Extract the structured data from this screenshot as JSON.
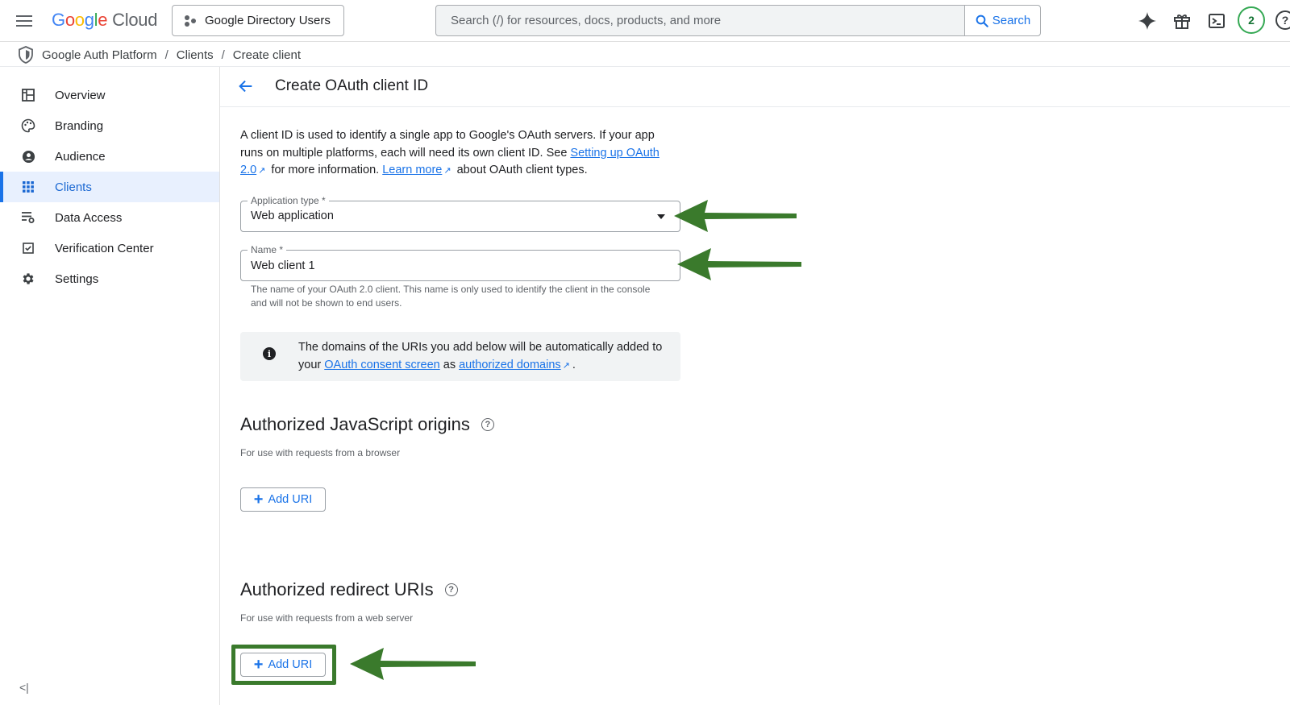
{
  "topbar": {
    "logo_letters": [
      "G",
      "o",
      "o",
      "g",
      "l",
      "e"
    ],
    "logo_product": "Cloud",
    "project_name": "Google Directory Users",
    "search_placeholder": "Search (/) for resources, docs, products, and more",
    "search_button": "Search",
    "avatar_initial": "2",
    "help_glyph": "?"
  },
  "breadcrumb": {
    "items": [
      "Google Auth Platform",
      "Clients",
      "Create client"
    ],
    "separator": "/"
  },
  "sidebar": {
    "items": [
      {
        "label": "Overview",
        "icon": "dashboard-icon"
      },
      {
        "label": "Branding",
        "icon": "palette-icon"
      },
      {
        "label": "Audience",
        "icon": "person-circle-icon"
      },
      {
        "label": "Clients",
        "icon": "grid-dots-icon",
        "active": true
      },
      {
        "label": "Data Access",
        "icon": "data-settings-icon"
      },
      {
        "label": "Verification Center",
        "icon": "checkbox-icon"
      },
      {
        "label": "Settings",
        "icon": "gear-icon"
      }
    ],
    "collapse_glyph": "<|"
  },
  "page": {
    "title": "Create OAuth client ID",
    "intro_part1": "A client ID is used to identify a single app to Google's OAuth servers. If your app runs on multiple platforms, each will need its own client ID. See ",
    "intro_link1": "Setting up OAuth 2.0",
    "intro_part2": " for more information. ",
    "intro_link2": "Learn more",
    "intro_part3": " about OAuth client types."
  },
  "form": {
    "app_type_label": "Application type *",
    "app_type_value": "Web application",
    "name_label": "Name *",
    "name_value": "Web client 1",
    "name_helper": "The name of your OAuth 2.0 client. This name is only used to identify the client in the console and will not be shown to end users."
  },
  "info": {
    "icon_glyph": "i",
    "text_part1": "The domains of the URIs you add below will be automatically added to your ",
    "link1": "OAuth consent screen",
    "text_part2": " as ",
    "link2": "authorized domains",
    "text_part3": "."
  },
  "js_origins": {
    "title": "Authorized JavaScript origins",
    "subtitle": "For use with requests from a browser",
    "button": "Add URI"
  },
  "redirect_uris": {
    "title": "Authorized redirect URIs",
    "subtitle": "For use with requests from a web server",
    "button": "Add URI"
  },
  "colors": {
    "accent": "#1a73e8",
    "annotation_green": "#3a7a2c",
    "active_nav_bg": "#e8f0fe"
  }
}
